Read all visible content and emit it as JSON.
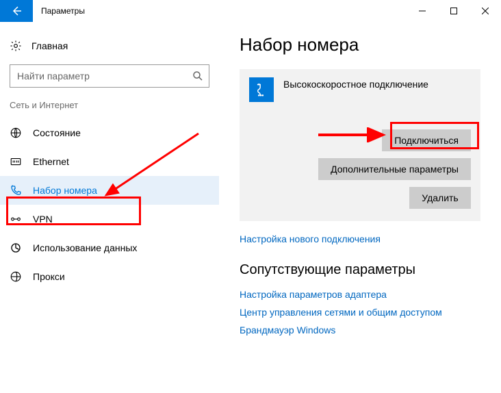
{
  "titlebar": {
    "title": "Параметры"
  },
  "sidebar": {
    "home": "Главная",
    "search_placeholder": "Найти параметр",
    "section": "Сеть и Интернет",
    "items": [
      {
        "label": "Состояние"
      },
      {
        "label": "Ethernet"
      },
      {
        "label": "Набор номера"
      },
      {
        "label": "VPN"
      },
      {
        "label": "Использование данных"
      },
      {
        "label": "Прокси"
      }
    ]
  },
  "main": {
    "title": "Набор номера",
    "connection_name": "Высокоскоростное подключение",
    "buttons": {
      "connect": "Подключиться",
      "advanced": "Дополнительные параметры",
      "delete": "Удалить"
    },
    "new_conn_link": "Настройка нового подключения",
    "related_heading": "Сопутствующие параметры",
    "related_links": [
      "Настройка параметров адаптера",
      "Центр управления сетями и общим доступом",
      "Брандмауэр Windows"
    ]
  }
}
